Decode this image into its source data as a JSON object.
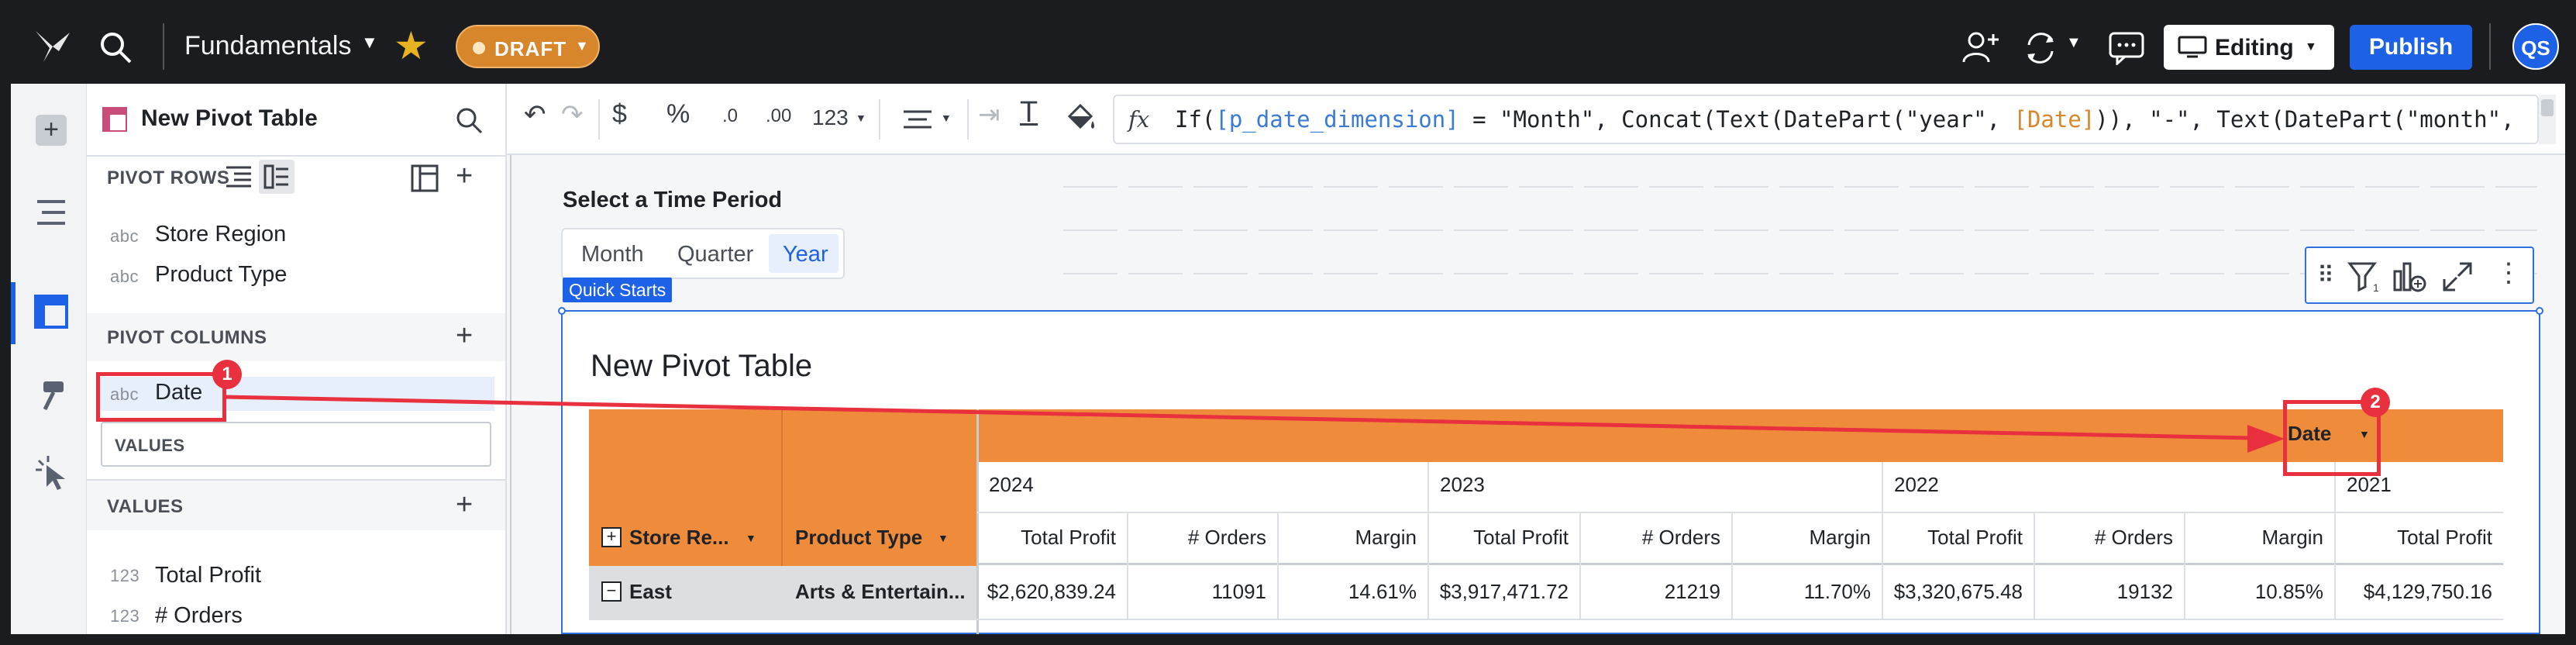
{
  "topbar": {
    "doc_title": "Fundamentals",
    "draft_label": "DRAFT",
    "editing_label": "Editing",
    "publish_label": "Publish",
    "avatar_initials": "QS"
  },
  "panel": {
    "title": "New Pivot Table",
    "pivot_rows_label": "PIVOT ROWS",
    "rows": [
      {
        "type": "abc",
        "label": "Store Region"
      },
      {
        "type": "abc",
        "label": "Product Type"
      }
    ],
    "pivot_columns_label": "PIVOT COLUMNS",
    "column_item": {
      "type": "abc",
      "label": "Date"
    },
    "values_drop_label": "VALUES",
    "values_label": "VALUES",
    "values": [
      {
        "type": "123",
        "label": "Total Profit"
      },
      {
        "type": "123",
        "label": "# Orders"
      }
    ]
  },
  "toolbar": {
    "number_format_label": "123",
    "fx_label": "fx"
  },
  "formula": {
    "p1": "If(",
    "col": "[p_date_dimension]",
    "p2": " = \"Month\", Concat(Text(DatePart(\"year\", ",
    "date": "[Date]",
    "p3": ")), \"-\", Text(DatePart(\"month\","
  },
  "control": {
    "title": "Select a Time Period",
    "options": [
      "Month",
      "Quarter",
      "Year"
    ],
    "selected": "Year",
    "tag": "Quick Starts"
  },
  "pivot": {
    "title": "New Pivot Table",
    "col_header": "Date",
    "row_headers": [
      "Store Re...",
      "Product Type"
    ],
    "years": [
      "2024",
      "2023",
      "2022",
      "2021"
    ],
    "measures": [
      "Total Profit",
      "# Orders",
      "Margin",
      "Total Profit",
      "# Orders",
      "Margin",
      "Total Profit",
      "# Orders",
      "Margin",
      "Total Profit"
    ],
    "first_row": {
      "region": "East",
      "product": "Arts & Entertain...",
      "values": [
        "$2,620,839.24",
        "11091",
        "14.61%",
        "$3,917,471.72",
        "21219",
        "11.70%",
        "$3,320,675.48",
        "19132",
        "10.85%",
        "$4,129,750.16"
      ]
    }
  },
  "annotations": {
    "badge1": "1",
    "badge2": "2"
  },
  "colors": {
    "accent": "#1d62e6",
    "pivot_header": "#ef8c3c",
    "annotation": "#e8303f",
    "draft": "#d8862b"
  }
}
